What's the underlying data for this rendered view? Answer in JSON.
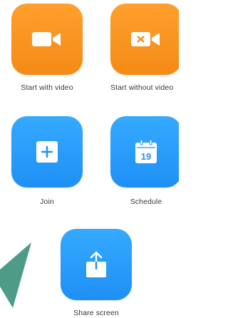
{
  "buttons": {
    "start_with_video": {
      "label": "Start with video",
      "icon": "video-camera-icon"
    },
    "start_without_video": {
      "label": "Start without video",
      "icon": "video-camera-off-icon"
    },
    "join": {
      "label": "Join",
      "icon": "plus-icon"
    },
    "schedule": {
      "label": "Schedule",
      "icon": "calendar-icon",
      "calendar_day": "19"
    },
    "share_screen": {
      "label": "Share screen",
      "icon": "share-upload-icon"
    }
  },
  "colors": {
    "orange": "#f7931f",
    "blue": "#2d9cff",
    "teal_shape": "#4e9c88"
  }
}
